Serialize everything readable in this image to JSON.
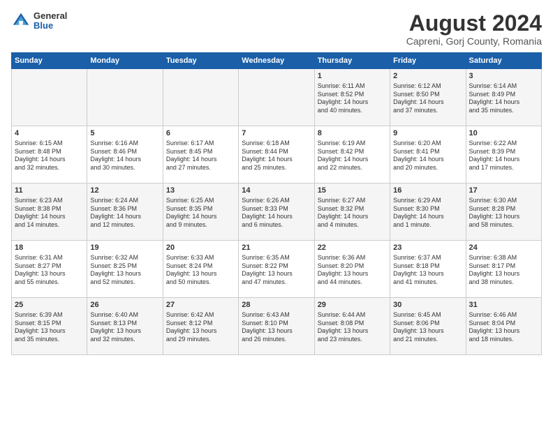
{
  "logo": {
    "general": "General",
    "blue": "Blue"
  },
  "title": "August 2024",
  "subtitle": "Capreni, Gorj County, Romania",
  "days_header": [
    "Sunday",
    "Monday",
    "Tuesday",
    "Wednesday",
    "Thursday",
    "Friday",
    "Saturday"
  ],
  "weeks": [
    [
      {
        "num": "",
        "info": ""
      },
      {
        "num": "",
        "info": ""
      },
      {
        "num": "",
        "info": ""
      },
      {
        "num": "",
        "info": ""
      },
      {
        "num": "1",
        "info": "Sunrise: 6:11 AM\nSunset: 8:52 PM\nDaylight: 14 hours\nand 40 minutes."
      },
      {
        "num": "2",
        "info": "Sunrise: 6:12 AM\nSunset: 8:50 PM\nDaylight: 14 hours\nand 37 minutes."
      },
      {
        "num": "3",
        "info": "Sunrise: 6:14 AM\nSunset: 8:49 PM\nDaylight: 14 hours\nand 35 minutes."
      }
    ],
    [
      {
        "num": "4",
        "info": "Sunrise: 6:15 AM\nSunset: 8:48 PM\nDaylight: 14 hours\nand 32 minutes."
      },
      {
        "num": "5",
        "info": "Sunrise: 6:16 AM\nSunset: 8:46 PM\nDaylight: 14 hours\nand 30 minutes."
      },
      {
        "num": "6",
        "info": "Sunrise: 6:17 AM\nSunset: 8:45 PM\nDaylight: 14 hours\nand 27 minutes."
      },
      {
        "num": "7",
        "info": "Sunrise: 6:18 AM\nSunset: 8:44 PM\nDaylight: 14 hours\nand 25 minutes."
      },
      {
        "num": "8",
        "info": "Sunrise: 6:19 AM\nSunset: 8:42 PM\nDaylight: 14 hours\nand 22 minutes."
      },
      {
        "num": "9",
        "info": "Sunrise: 6:20 AM\nSunset: 8:41 PM\nDaylight: 14 hours\nand 20 minutes."
      },
      {
        "num": "10",
        "info": "Sunrise: 6:22 AM\nSunset: 8:39 PM\nDaylight: 14 hours\nand 17 minutes."
      }
    ],
    [
      {
        "num": "11",
        "info": "Sunrise: 6:23 AM\nSunset: 8:38 PM\nDaylight: 14 hours\nand 14 minutes."
      },
      {
        "num": "12",
        "info": "Sunrise: 6:24 AM\nSunset: 8:36 PM\nDaylight: 14 hours\nand 12 minutes."
      },
      {
        "num": "13",
        "info": "Sunrise: 6:25 AM\nSunset: 8:35 PM\nDaylight: 14 hours\nand 9 minutes."
      },
      {
        "num": "14",
        "info": "Sunrise: 6:26 AM\nSunset: 8:33 PM\nDaylight: 14 hours\nand 6 minutes."
      },
      {
        "num": "15",
        "info": "Sunrise: 6:27 AM\nSunset: 8:32 PM\nDaylight: 14 hours\nand 4 minutes."
      },
      {
        "num": "16",
        "info": "Sunrise: 6:29 AM\nSunset: 8:30 PM\nDaylight: 14 hours\nand 1 minute."
      },
      {
        "num": "17",
        "info": "Sunrise: 6:30 AM\nSunset: 8:28 PM\nDaylight: 13 hours\nand 58 minutes."
      }
    ],
    [
      {
        "num": "18",
        "info": "Sunrise: 6:31 AM\nSunset: 8:27 PM\nDaylight: 13 hours\nand 55 minutes."
      },
      {
        "num": "19",
        "info": "Sunrise: 6:32 AM\nSunset: 8:25 PM\nDaylight: 13 hours\nand 52 minutes."
      },
      {
        "num": "20",
        "info": "Sunrise: 6:33 AM\nSunset: 8:24 PM\nDaylight: 13 hours\nand 50 minutes."
      },
      {
        "num": "21",
        "info": "Sunrise: 6:35 AM\nSunset: 8:22 PM\nDaylight: 13 hours\nand 47 minutes."
      },
      {
        "num": "22",
        "info": "Sunrise: 6:36 AM\nSunset: 8:20 PM\nDaylight: 13 hours\nand 44 minutes."
      },
      {
        "num": "23",
        "info": "Sunrise: 6:37 AM\nSunset: 8:18 PM\nDaylight: 13 hours\nand 41 minutes."
      },
      {
        "num": "24",
        "info": "Sunrise: 6:38 AM\nSunset: 8:17 PM\nDaylight: 13 hours\nand 38 minutes."
      }
    ],
    [
      {
        "num": "25",
        "info": "Sunrise: 6:39 AM\nSunset: 8:15 PM\nDaylight: 13 hours\nand 35 minutes."
      },
      {
        "num": "26",
        "info": "Sunrise: 6:40 AM\nSunset: 8:13 PM\nDaylight: 13 hours\nand 32 minutes."
      },
      {
        "num": "27",
        "info": "Sunrise: 6:42 AM\nSunset: 8:12 PM\nDaylight: 13 hours\nand 29 minutes."
      },
      {
        "num": "28",
        "info": "Sunrise: 6:43 AM\nSunset: 8:10 PM\nDaylight: 13 hours\nand 26 minutes."
      },
      {
        "num": "29",
        "info": "Sunrise: 6:44 AM\nSunset: 8:08 PM\nDaylight: 13 hours\nand 23 minutes."
      },
      {
        "num": "30",
        "info": "Sunrise: 6:45 AM\nSunset: 8:06 PM\nDaylight: 13 hours\nand 21 minutes."
      },
      {
        "num": "31",
        "info": "Sunrise: 6:46 AM\nSunset: 8:04 PM\nDaylight: 13 hours\nand 18 minutes."
      }
    ]
  ]
}
